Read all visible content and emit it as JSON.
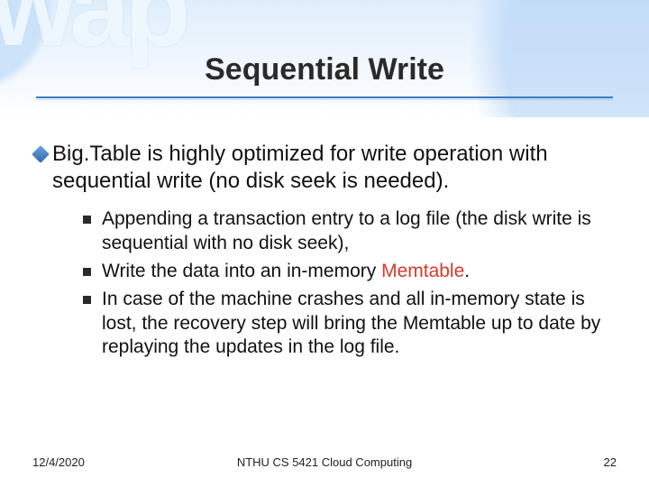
{
  "title": "Sequential Write",
  "bullets": {
    "main": "Big.Table is highly optimized for write operation with sequential write (no disk seek is needed).",
    "subs": [
      "Appending a transaction entry to a log file (the disk write is sequential with no disk seek),",
      {
        "pre": "Write the data into an in-memory ",
        "hl": "Memtable",
        "post": "."
      },
      "In case of the machine crashes and all in-memory state is lost, the recovery step will bring the Memtable up to date by replaying the updates in the log file."
    ]
  },
  "footer": {
    "date": "12/4/2020",
    "course": "NTHU CS 5421 Cloud Computing",
    "page": "22"
  },
  "decor": {
    "bg_letters": "wap"
  }
}
